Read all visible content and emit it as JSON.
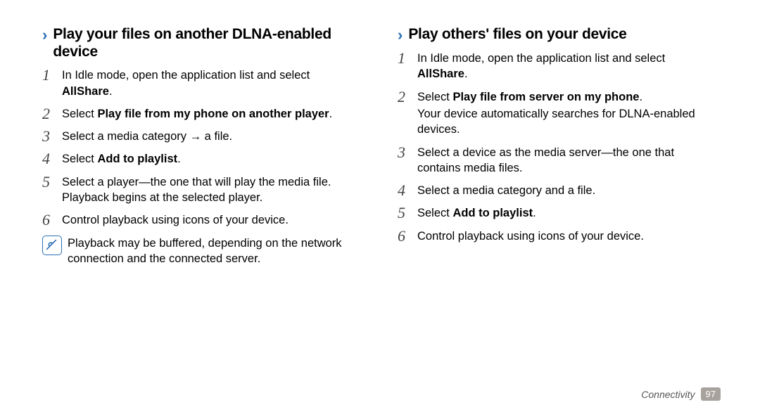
{
  "left": {
    "heading": "Play your files on another DLNA-enabled device",
    "steps": [
      {
        "n": "1",
        "text_pre": "In Idle mode, open the application list and select ",
        "text_bold": "AllShare",
        "text_post": "."
      },
      {
        "n": "2",
        "text_pre": "Select ",
        "text_bold": "Play file from my phone on another player",
        "text_post": "."
      },
      {
        "n": "3",
        "text_pre": "Select a media category → a file.",
        "text_bold": "",
        "text_post": ""
      },
      {
        "n": "4",
        "text_pre": "Select ",
        "text_bold": "Add to playlist",
        "text_post": "."
      },
      {
        "n": "5",
        "text_pre": "Select a player—the one that will play the media file. Playback begins at the selected player.",
        "text_bold": "",
        "text_post": ""
      },
      {
        "n": "6",
        "text_pre": "Control playback using icons of your device.",
        "text_bold": "",
        "text_post": ""
      }
    ],
    "note": "Playback may be buffered, depending on the network connection and the connected server."
  },
  "right": {
    "heading": "Play others' files on your device",
    "steps": [
      {
        "n": "1",
        "text_pre": "In Idle mode, open the application list and select ",
        "text_bold": "AllShare",
        "text_post": "."
      },
      {
        "n": "2",
        "text_pre": "Select ",
        "text_bold": "Play file from server on my phone",
        "text_post": ".",
        "sub": "Your device automatically searches for DLNA-enabled devices."
      },
      {
        "n": "3",
        "text_pre": "Select a device as the media server—the one that contains media files.",
        "text_bold": "",
        "text_post": ""
      },
      {
        "n": "4",
        "text_pre": "Select a media category and a file.",
        "text_bold": "",
        "text_post": ""
      },
      {
        "n": "5",
        "text_pre": "Select ",
        "text_bold": "Add to playlist",
        "text_post": "."
      },
      {
        "n": "6",
        "text_pre": "Control playback using icons of your device.",
        "text_bold": "",
        "text_post": ""
      }
    ]
  },
  "footer": {
    "section": "Connectivity",
    "page": "97"
  },
  "glyphs": {
    "arrow": "›"
  }
}
